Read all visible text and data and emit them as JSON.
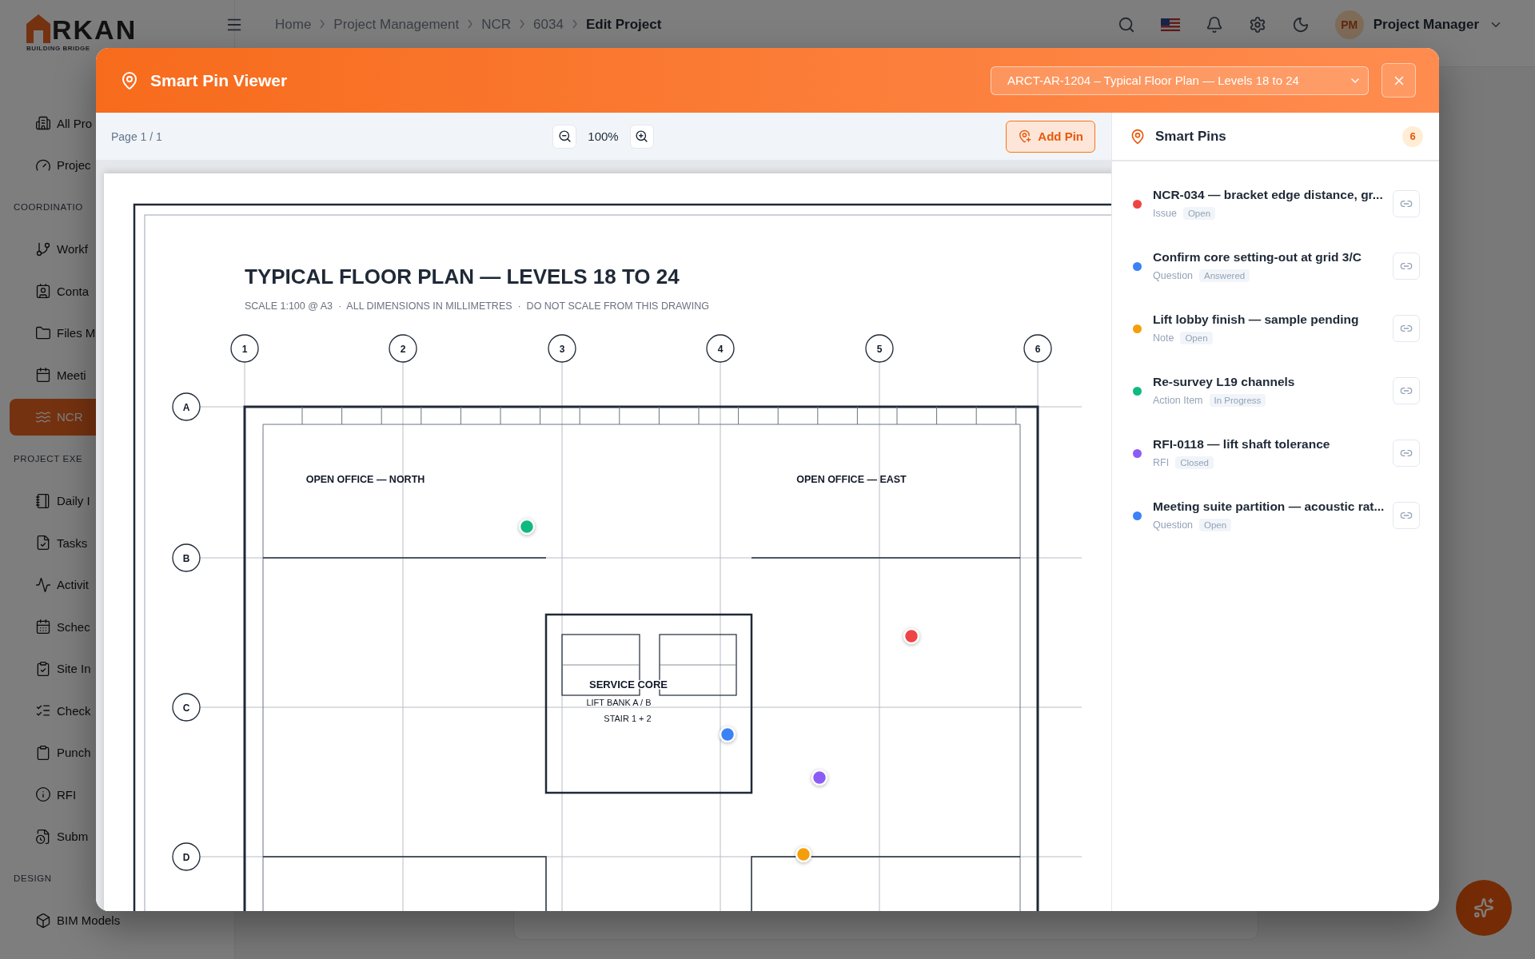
{
  "logo": {
    "text": "RKAN",
    "tagline": "BUILDING BRIDGE"
  },
  "sidebar": {
    "items": [
      {
        "kind": "item",
        "label": "All Pro",
        "selected": false
      },
      {
        "kind": "item",
        "label": "Projec",
        "selected": false
      },
      {
        "kind": "section",
        "label": "COORDINATIO"
      },
      {
        "kind": "item",
        "label": "Workf",
        "selected": false
      },
      {
        "kind": "item",
        "label": "Conta",
        "selected": false
      },
      {
        "kind": "item",
        "label": "Files M",
        "selected": false
      },
      {
        "kind": "item",
        "label": "Meeti",
        "selected": false
      },
      {
        "kind": "item",
        "label": "NCR",
        "selected": true
      },
      {
        "kind": "section",
        "label": "PROJECT EXE"
      },
      {
        "kind": "item",
        "label": "Daily I",
        "selected": false
      },
      {
        "kind": "item",
        "label": "Tasks",
        "selected": false
      },
      {
        "kind": "item",
        "label": "Activit",
        "selected": false
      },
      {
        "kind": "item",
        "label": "Schec",
        "selected": false
      },
      {
        "kind": "item",
        "label": "Site In",
        "selected": false
      },
      {
        "kind": "item",
        "label": "Check",
        "selected": false
      },
      {
        "kind": "item",
        "label": "Punch",
        "selected": false
      },
      {
        "kind": "item",
        "label": "RFI",
        "selected": false
      },
      {
        "kind": "item",
        "label": "Subm",
        "selected": false
      },
      {
        "kind": "section",
        "label": "DESIGN"
      },
      {
        "kind": "item",
        "label": "BIM Models",
        "selected": false
      }
    ]
  },
  "header": {
    "breadcrumb": [
      "Home",
      "Project Management",
      "NCR",
      "6034",
      "Edit Project"
    ],
    "user": {
      "initials": "PM",
      "name": "Project Manager"
    }
  },
  "modal": {
    "title": "Smart Pin Viewer",
    "sheet_select": "ARCT-AR-1204 – Typical Floor Plan — Levels 18 to 24",
    "toolbar": {
      "page": "Page 1 / 1",
      "zoom": "100%",
      "add_pin": "Add Pin"
    },
    "drawing": {
      "title": "TYPICAL FLOOR PLAN — LEVELS 18 TO 24",
      "subtitle": "SCALE 1:100 @ A3  ·  ALL DIMENSIONS IN MILLIMETRES  ·  DO NOT SCALE FROM THIS DRAWING",
      "columns": [
        "1",
        "2",
        "3",
        "4",
        "5",
        "6"
      ],
      "rows": [
        "A",
        "B",
        "C",
        "D"
      ],
      "rooms": [
        "OPEN OFFICE — NORTH",
        "OPEN OFFICE — EAST"
      ],
      "core": {
        "label": "SERVICE CORE",
        "lines": [
          "LIFT BANK A / B",
          "STAIR 1 + 2"
        ]
      }
    },
    "pins_panel": {
      "title": "Smart Pins",
      "count": "6",
      "pins": [
        {
          "title": "NCR-034 — bracket edge distance, gr...",
          "type": "Issue",
          "status": "Open",
          "color": "#ef4444"
        },
        {
          "title": "Confirm core setting-out at grid 3/C",
          "type": "Question",
          "status": "Answered",
          "color": "#3b82f6"
        },
        {
          "title": "Lift lobby finish — sample pending",
          "type": "Note",
          "status": "Open",
          "color": "#f59e0b"
        },
        {
          "title": "Re-survey L19 channels",
          "type": "Action Item",
          "status": "In Progress",
          "color": "#10b981"
        },
        {
          "title": "RFI-0118 — lift shaft tolerance",
          "type": "RFI",
          "status": "Closed",
          "color": "#8b5cf6"
        },
        {
          "title": "Meeting suite partition — acoustic rat...",
          "type": "Question",
          "status": "Open",
          "color": "#3b82f6"
        }
      ]
    }
  }
}
